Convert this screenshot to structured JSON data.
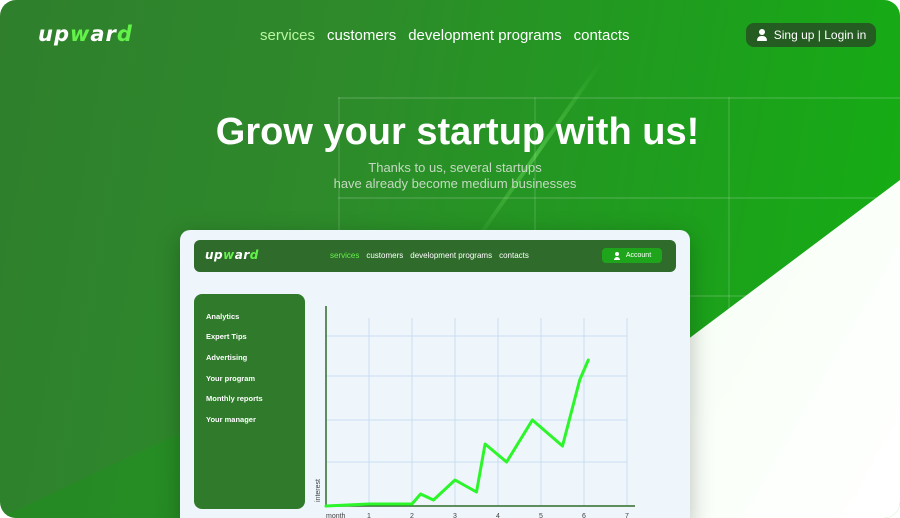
{
  "brand": {
    "logo_main": "up",
    "logo_accent_1": "w",
    "logo_mid": "ar",
    "logo_accent_2": "d"
  },
  "nav": {
    "items": [
      "services",
      "customers",
      "development programs",
      "contacts"
    ],
    "active_index": 0
  },
  "auth": {
    "label": "Sing up | Login in",
    "icon": "user-icon"
  },
  "hero": {
    "title": "Grow your startup with us!",
    "subtitle_line1": "Thanks to us, several startups",
    "subtitle_line2": "have already become medium businesses"
  },
  "preview": {
    "nav_items": [
      "services",
      "customers",
      "development programs",
      "contacts"
    ],
    "account_label": "Account",
    "sidebar_items": [
      "Analytics",
      "Expert Tips",
      "Advertising",
      "Your program",
      "Monthly reports",
      "Your manager"
    ]
  },
  "colors": {
    "accent": "#63f24a",
    "primary_green": "#2f7a2b",
    "line": "#2cf52a"
  },
  "chart_data": {
    "type": "line",
    "xlabel": "month",
    "ylabel": "interest",
    "x_ticks": [
      "1",
      "2",
      "3",
      "4",
      "5",
      "6",
      "7"
    ],
    "xlim": [
      0,
      7
    ],
    "ylim": [
      0,
      1
    ],
    "grid": true,
    "series": [
      {
        "x": [
          0,
          1,
          2,
          2.2,
          2.5,
          3.0,
          3.5,
          3.7,
          4.2,
          4.8,
          5.5,
          5.9,
          6.1
        ],
        "y": [
          0,
          0.01,
          0.01,
          0.06,
          0.03,
          0.13,
          0.07,
          0.31,
          0.22,
          0.43,
          0.3,
          0.63,
          0.73
        ]
      }
    ]
  }
}
